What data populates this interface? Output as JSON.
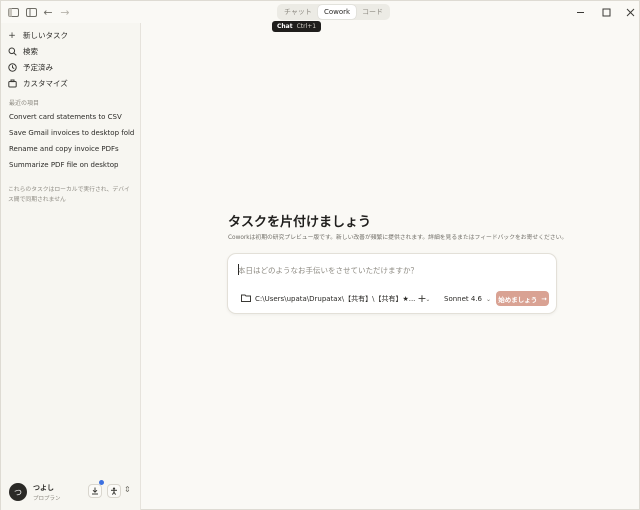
{
  "titlebar": {
    "modes": [
      {
        "label": "チャット",
        "active": false
      },
      {
        "label": "Cowork",
        "active": true
      },
      {
        "label": "コード",
        "active": false
      }
    ],
    "tooltip": {
      "label": "Chat",
      "shortcut": "Ctrl+1"
    },
    "icons": [
      "sidebar-toggle-icon",
      "back-arrow-icon",
      "forward-arrow-icon",
      "minimize-icon",
      "maximize-icon",
      "close-icon"
    ]
  },
  "sidebar": {
    "nav": [
      {
        "label": "新しいタスク",
        "icon": "plus-icon"
      },
      {
        "label": "検索",
        "icon": "search-icon"
      },
      {
        "label": "予定済み",
        "icon": "clock-icon"
      },
      {
        "label": "カスタマイズ",
        "icon": "briefcase-icon"
      }
    ],
    "recents_label": "最近の項目",
    "recents": [
      "Convert card statements to CSV",
      "Save Gmail invoices to desktop fold",
      "Rename and copy invoice PDFs",
      "Summarize PDF file on desktop"
    ],
    "local_note": "これらのタスクはローカルで実行され、デバイス間で同期されません",
    "user": {
      "initial": "つ",
      "name": "つよし",
      "plan": "プロプラン"
    }
  },
  "main": {
    "headline": "タスクを片付けましょう",
    "subtext": "Coworkは初期の研究プレビュー版です。新しい改善が頻繁に提供されます。詳細を見るまたはフィードバックをお寄せください。",
    "composer": {
      "placeholder": "本日はどのようなお手伝いをさせていただけますか？",
      "folder": "C:\\Users\\upata\\Drupatax\\【共有】\\【共有】★...",
      "model": "Sonnet 4.6",
      "start_label": "始めましょう",
      "start_icon": "→"
    }
  },
  "colors": {
    "background": "#faf9f5",
    "sidebar": "#f7f6f1",
    "accent_button": "#d9a293",
    "tooltip_bg": "#1f1e1c"
  }
}
